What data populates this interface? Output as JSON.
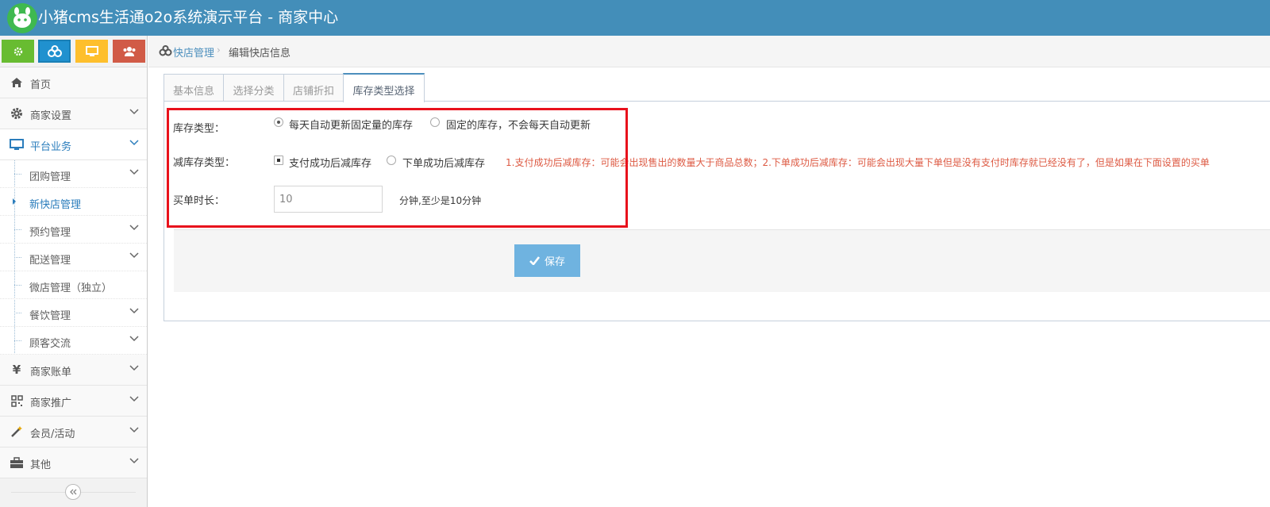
{
  "header": {
    "title": "小猪cms生活通o2o系统演示平台 - 商家中心",
    "logo_icon": "pig-logo-icon",
    "bg_color": "#438eb9"
  },
  "shortcuts": [
    {
      "icon": "gear-icon",
      "color": "#68bc31"
    },
    {
      "icon": "cogs-icon",
      "color": "#2091cf"
    },
    {
      "icon": "desktop-icon",
      "color": "#febf2c"
    },
    {
      "icon": "users-icon",
      "color": "#d15b47"
    }
  ],
  "sidebar": {
    "items": [
      {
        "label": "首页",
        "icon": "home-icon"
      },
      {
        "label": "商家设置",
        "icon": "gear-icon"
      },
      {
        "label": "平台业务",
        "icon": "desktop-icon"
      }
    ],
    "sub_items": [
      {
        "label": "团购管理"
      },
      {
        "label": "新快店管理"
      },
      {
        "label": "预约管理"
      },
      {
        "label": "配送管理"
      },
      {
        "label": "微店管理（独立）"
      },
      {
        "label": "餐饮管理"
      },
      {
        "label": "顾客交流"
      }
    ],
    "bottom_items": [
      {
        "label": "商家账单",
        "icon": "yen-icon"
      },
      {
        "label": "商家推广",
        "icon": "qrcode-icon"
      },
      {
        "label": "会员/活动",
        "icon": "magic-wand-icon"
      },
      {
        "label": "其他",
        "icon": "briefcase-icon"
      }
    ]
  },
  "breadcrumb": {
    "link": "快店管理",
    "separator": "›",
    "current": "编辑快店信息"
  },
  "tabs": [
    {
      "label": "基本信息"
    },
    {
      "label": "选择分类"
    },
    {
      "label": "店铺折扣"
    },
    {
      "label": "库存类型选择"
    }
  ],
  "form": {
    "stock_type": {
      "label": "库存类型：",
      "options": [
        "每天自动更新固定量的库存",
        "固定的库存，不会每天自动更新"
      ],
      "selected": 0
    },
    "reduce_type": {
      "label": "减库存类型：",
      "options": [
        "支付成功后减库存",
        "下单成功后减库存"
      ],
      "selected": 0,
      "hint": "1.支付成功后减库存：可能会出现售出的数量大于商品总数；2.下单成功后减库存：可能会出现大量下单但是没有支付时库存就已经没有了，但是如果在下面设置的买单"
    },
    "pay_time": {
      "label": "买单时长：",
      "value": "10",
      "help": "分钟,至少是10分钟"
    },
    "save_label": "保存"
  },
  "colors": {
    "highlight_border": "#e8111c",
    "hint_text": "#dd5a43",
    "save_button": "#6fb3e0"
  }
}
